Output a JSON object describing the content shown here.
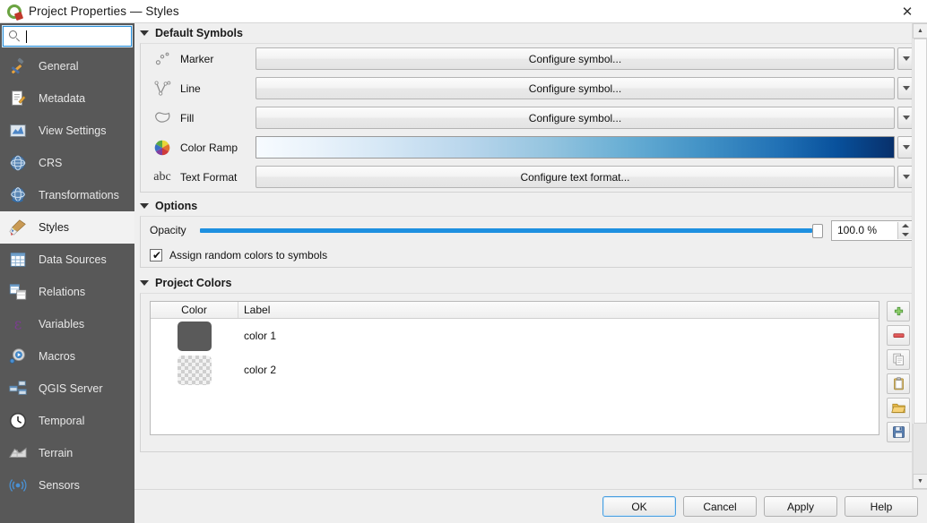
{
  "window": {
    "title": "Project Properties — Styles",
    "app_icon": "qgis-logo-icon",
    "close_label": "✕"
  },
  "sidebar": {
    "search": {
      "value": "",
      "placeholder": ""
    },
    "items": [
      {
        "label": "General",
        "icon": "hammer-wrench-icon",
        "selected": false
      },
      {
        "label": "Metadata",
        "icon": "document-pencil-icon",
        "selected": false
      },
      {
        "label": "View Settings",
        "icon": "map-view-icon",
        "selected": false
      },
      {
        "label": "CRS",
        "icon": "globe-grid-icon",
        "selected": false
      },
      {
        "label": "Transformations",
        "icon": "globe-arrow-icon",
        "selected": false
      },
      {
        "label": "Styles",
        "icon": "paintbrush-icon",
        "selected": true
      },
      {
        "label": "Data Sources",
        "icon": "table-icon",
        "selected": false
      },
      {
        "label": "Relations",
        "icon": "two-tables-icon",
        "selected": false
      },
      {
        "label": "Variables",
        "icon": "epsilon-icon",
        "selected": false
      },
      {
        "label": "Macros",
        "icon": "gear-play-icon",
        "selected": false
      },
      {
        "label": "QGIS Server",
        "icon": "servers-icon",
        "selected": false
      },
      {
        "label": "Temporal",
        "icon": "clock-icon",
        "selected": false
      },
      {
        "label": "Terrain",
        "icon": "terrain-mesh-icon",
        "selected": false
      },
      {
        "label": "Sensors",
        "icon": "signal-waves-icon",
        "selected": false
      }
    ]
  },
  "default_symbols": {
    "header": "Default Symbols",
    "rows": [
      {
        "label": "Marker",
        "icon": "point-marker-icon",
        "button": "Configure symbol...",
        "type": "button"
      },
      {
        "label": "Line",
        "icon": "polyline-icon",
        "button": "Configure symbol...",
        "type": "button"
      },
      {
        "label": "Fill",
        "icon": "polygon-fill-icon",
        "button": "Configure symbol...",
        "type": "button"
      },
      {
        "label": "Color Ramp",
        "icon": "color-wheel-icon",
        "button": "",
        "type": "ramp"
      },
      {
        "label": "Text Format",
        "icon": "abc-text-icon",
        "button": "Configure text format...",
        "type": "button"
      }
    ],
    "color_ramp": {
      "name": "Blues",
      "stops": [
        "#f7fbff",
        "#deebf7",
        "#c6dbef",
        "#9ecae1",
        "#6baed6",
        "#4292c6",
        "#2171b5",
        "#08519c",
        "#08306b"
      ]
    }
  },
  "options": {
    "header": "Options",
    "opacity": {
      "label": "Opacity",
      "value": "100.0 %",
      "percent": 100
    },
    "assign_random_colors": {
      "label": "Assign random colors to symbols",
      "checked": true,
      "tick": "✔"
    }
  },
  "project_colors": {
    "header": "Project Colors",
    "columns": [
      "Color",
      "Label"
    ],
    "rows": [
      {
        "label": "color 1",
        "color": "#5a5a5a",
        "transparent": false
      },
      {
        "label": "color 2",
        "color": "transparent",
        "transparent": true
      }
    ],
    "tools": [
      {
        "name": "add-color-button",
        "icon": "plus-icon"
      },
      {
        "name": "remove-color-button",
        "icon": "minus-icon"
      },
      {
        "name": "copy-colors-button",
        "icon": "copy-icon"
      },
      {
        "name": "paste-colors-button",
        "icon": "paste-icon"
      },
      {
        "name": "import-colors-button",
        "icon": "folder-open-icon"
      },
      {
        "name": "export-colors-button",
        "icon": "floppy-save-icon"
      }
    ]
  },
  "buttons": {
    "ok": "OK",
    "cancel": "Cancel",
    "apply": "Apply",
    "help": "Help"
  },
  "colors": {
    "sidebar_bg": "#585858",
    "accent_blue": "#1e90e0",
    "focus_blue": "#2a8fd8",
    "content_bg": "#efefef"
  }
}
